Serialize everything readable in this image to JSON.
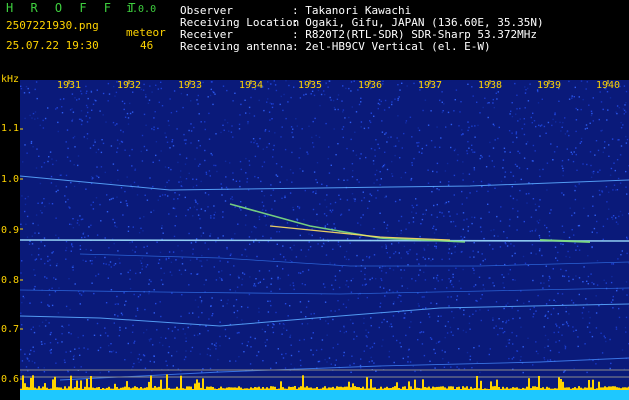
{
  "header": {
    "logo": "H R O F F T",
    "version": "1.0.0",
    "filename": "2507221930.png",
    "datetime": "25.07.22 19:30",
    "meteor_label": "meteor",
    "meteor_count": "46",
    "info": [
      {
        "key": "Observer",
        "value": ": Takanori Kawachi"
      },
      {
        "key": "Receiving Location",
        "value": ": Ogaki, Gifu, JAPAN (136.60E, 35.35N)"
      },
      {
        "key": "Receiver",
        "value": ": R820T2(RTL-SDR) SDR-Sharp 53.372MHz"
      },
      {
        "key": "Receiving antenna",
        "value": ": 2el-HB9CV Vertical (el. E-W)"
      }
    ]
  },
  "axis": {
    "unit": "kHz",
    "y_ticks": [
      "1.1",
      "1.0",
      "0.9",
      "0.8",
      "0.7",
      "0.6"
    ],
    "x_ticks": [
      "1931",
      "1932",
      "1933",
      "1934",
      "1935",
      "1936",
      "1937",
      "1938",
      "1939",
      "1940"
    ]
  },
  "colors": {
    "background": "#0a1a7a",
    "accent_yellow": "#ffd400",
    "logo_green": "#3ecf3e",
    "baseline_cyan": "#1ec8ff"
  }
}
